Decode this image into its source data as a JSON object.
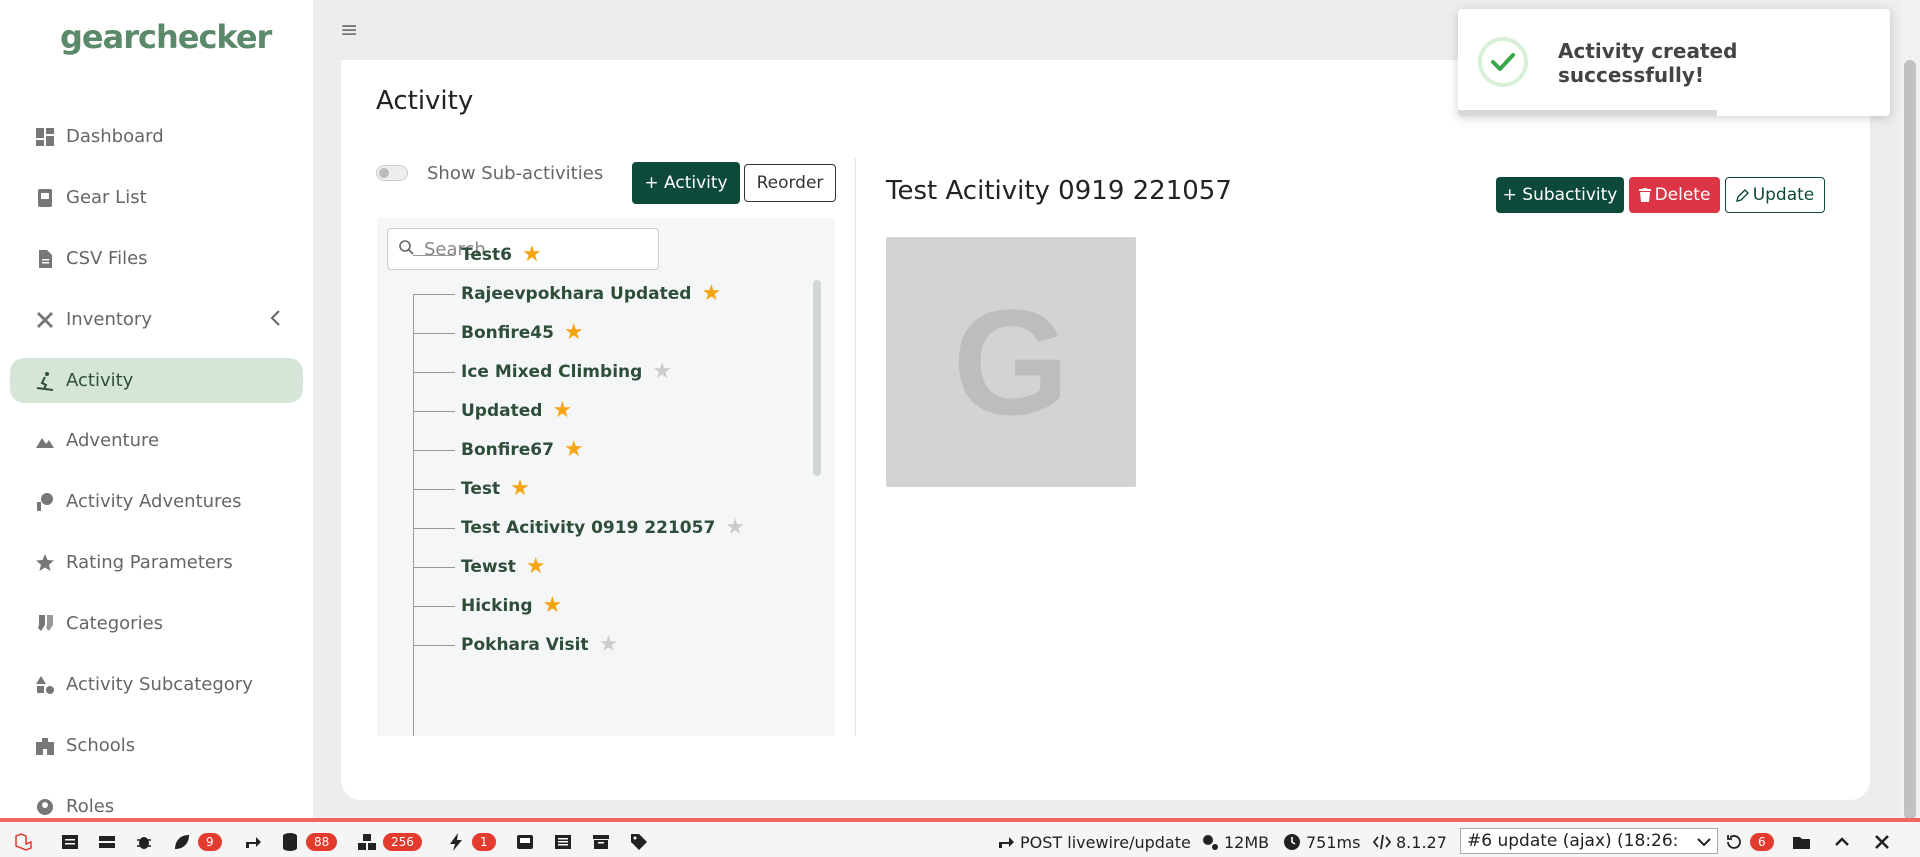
{
  "app": {
    "logo": "gearchecker"
  },
  "sidebar": {
    "items": [
      {
        "label": "Dashboard",
        "icon": "dashboard-icon"
      },
      {
        "label": "Gear List",
        "icon": "gear-list-icon"
      },
      {
        "label": "CSV Files",
        "icon": "file-icon"
      },
      {
        "label": "Inventory",
        "icon": "tools-icon"
      },
      {
        "label": "Activity",
        "icon": "skier-icon",
        "active": true
      },
      {
        "label": "Adventure",
        "icon": "mountain-icon"
      },
      {
        "label": "Activity Adventures",
        "icon": "activity-adventures-icon"
      },
      {
        "label": "Rating Parameters",
        "icon": "stars-icon"
      },
      {
        "label": "Categories",
        "icon": "socks-icon"
      },
      {
        "label": "Activity Subcategory",
        "icon": "shapes-icon"
      },
      {
        "label": "Schools",
        "icon": "school-icon"
      },
      {
        "label": "Roles",
        "icon": "roles-icon"
      }
    ]
  },
  "main": {
    "title": "Activity",
    "toggle_label": "Show Sub-activities",
    "add_activity_label": "+ Activity",
    "reorder_label": "Reorder",
    "search_placeholder": "Search",
    "tree": [
      {
        "label": "Test6",
        "starred": true
      },
      {
        "label": "Rajeevpokhara Updated",
        "starred": true
      },
      {
        "label": "Bonfire45",
        "starred": true
      },
      {
        "label": "Ice Mixed Climbing",
        "starred": false
      },
      {
        "label": "Updated",
        "starred": true
      },
      {
        "label": "Bonfire67",
        "starred": true
      },
      {
        "label": "Test",
        "starred": true
      },
      {
        "label": "Test Acitivity 0919 221057",
        "starred": false
      },
      {
        "label": "Tewst",
        "starred": true
      },
      {
        "label": "Hicking",
        "starred": true
      },
      {
        "label": "Pokhara Visit",
        "starred": false
      }
    ],
    "detail": {
      "title": "Test Acitivity 0919 221057",
      "subactivity_label": "+ Subactivity",
      "delete_label": "Delete",
      "update_label": "Update",
      "placeholder_letter": "G"
    }
  },
  "toast": {
    "message": "Activity created successfully!",
    "progress": 0.6
  },
  "debugbar": {
    "badges": {
      "messages": "9",
      "queries": "88",
      "models": "256",
      "events": "1",
      "history": "6"
    },
    "request": "POST livewire/update",
    "memory": "12MB",
    "time": "751ms",
    "php_version": "8.1.27",
    "select_value": "#6 update (ajax) (18:26:"
  },
  "colors": {
    "primary": "#0d4a3a",
    "danger": "#dc3545",
    "star": "#f5a414",
    "active_bg": "#d5e6d9",
    "debug_red": "#f4645f"
  }
}
